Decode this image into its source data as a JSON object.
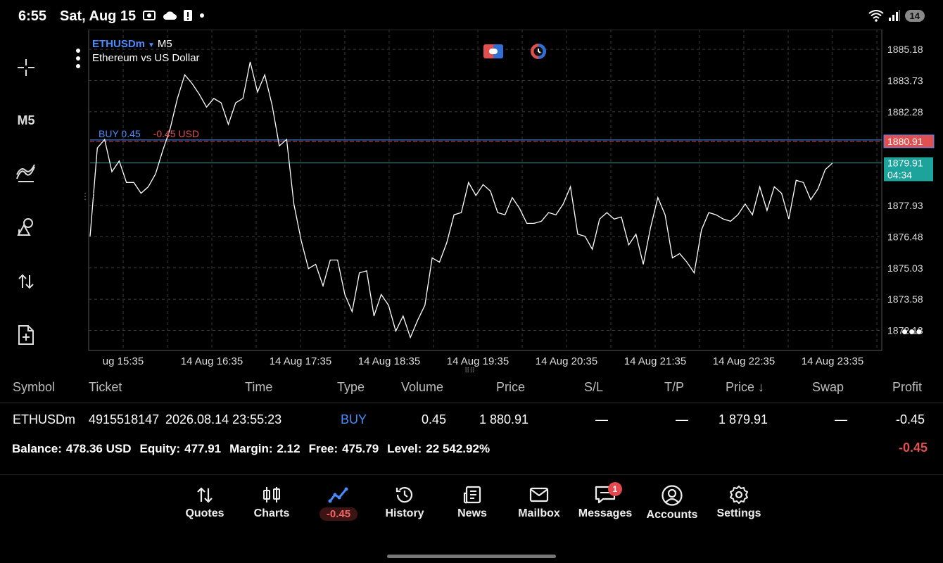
{
  "status_bar": {
    "time": "6:55",
    "date": "Sat, Aug 15",
    "battery": "14"
  },
  "left_toolbar": {
    "timeframe": "M5"
  },
  "chart": {
    "symbol": "ETHUSDm",
    "timeframe": "M5",
    "description": "Ethereum vs US Dollar",
    "order_label": "BUY 0.45",
    "order_pl": "-0.45 USD",
    "open_price_tag": "1880.91",
    "bid_tag": "1879.91",
    "bar_countdown": "04:34",
    "colors": {
      "line": "#ffffff",
      "grid": "#3a3a3a",
      "open_line": "#e05050",
      "bid_line": "#1ba39c",
      "buy": "#4a8cff"
    }
  },
  "chart_data": {
    "type": "line",
    "y_ticks": [
      "1885.18",
      "1883.73",
      "1882.28",
      "1877.93",
      "1876.48",
      "1875.03",
      "1873.58",
      "1872.13"
    ],
    "x_ticks": [
      "ug 15:35",
      "14 Aug 16:35",
      "14 Aug 17:35",
      "14 Aug 18:35",
      "14 Aug 19:35",
      "14 Aug 20:35",
      "14 Aug 21:35",
      "14 Aug 22:35",
      "14 Aug 23:35"
    ],
    "ylim": [
      1871.2,
      1886.1
    ],
    "open_price": 1880.91,
    "bid": 1879.91,
    "series": [
      {
        "values": [
          1876.5,
          1880.6,
          1881.0,
          1879.5,
          1880.0,
          1879.0,
          1879.0,
          1878.5,
          1878.8,
          1879.4,
          1880.5,
          1881.5,
          1882.9,
          1884.0,
          1883.6,
          1883.1,
          1882.5,
          1882.9,
          1882.7,
          1881.7,
          1882.7,
          1882.9,
          1884.6,
          1883.2,
          1884.0,
          1882.6,
          1880.7,
          1881.0,
          1878.0,
          1876.3,
          1875.0,
          1875.2,
          1874.2,
          1875.4,
          1875.4,
          1873.8,
          1873.0,
          1874.8,
          1874.9,
          1872.8,
          1873.8,
          1873.3,
          1872.1,
          1872.8,
          1871.8,
          1872.6,
          1873.3,
          1875.5,
          1875.3,
          1876.2,
          1877.5,
          1877.6,
          1879.0,
          1878.4,
          1878.9,
          1878.6,
          1877.6,
          1877.5,
          1878.3,
          1877.8,
          1877.1,
          1877.1,
          1877.2,
          1877.6,
          1877.5,
          1878.0,
          1878.8,
          1876.6,
          1876.5,
          1875.9,
          1877.3,
          1877.6,
          1877.3,
          1877.4,
          1876.1,
          1876.6,
          1875.2,
          1876.9,
          1878.3,
          1877.5,
          1875.5,
          1875.7,
          1875.3,
          1874.8,
          1876.8,
          1877.6,
          1877.5,
          1877.3,
          1877.2,
          1877.5,
          1878.0,
          1877.5,
          1878.8,
          1877.7,
          1878.8,
          1878.5,
          1877.3,
          1879.1,
          1879.0,
          1878.2,
          1878.7,
          1879.6,
          1879.9
        ]
      }
    ]
  },
  "positions": {
    "headers": {
      "symbol": "Symbol",
      "ticket": "Ticket",
      "time": "Time",
      "type": "Type",
      "volume": "Volume",
      "price": "Price",
      "sl": "S/L",
      "tp": "T/P",
      "price_current": "Price ↓",
      "swap": "Swap",
      "profit": "Profit"
    },
    "row": {
      "symbol": "ETHUSDm",
      "ticket": "4915518147",
      "time": "2026.08.14 23:55:23",
      "type": "BUY",
      "volume": "0.45",
      "price": "1 880.91",
      "sl": "—",
      "tp": "—",
      "price_current": "1 879.91",
      "swap": "—",
      "profit": "-0.45"
    },
    "summary": {
      "balance_label": "Balance:",
      "balance": "478.36 USD",
      "equity_label": "Equity:",
      "equity": "477.91",
      "margin_label": "Margin:",
      "margin": "2.12",
      "free_label": "Free:",
      "free": "475.79",
      "level_label": "Level:",
      "level": "22 542.92%",
      "profit": "-0.45"
    }
  },
  "nav": {
    "quotes": "Quotes",
    "charts": "Charts",
    "trade": "-0.45",
    "history": "History",
    "news": "News",
    "mailbox": "Mailbox",
    "messages": "Messages",
    "messages_badge": "1",
    "accounts": "Accounts",
    "settings": "Settings"
  }
}
